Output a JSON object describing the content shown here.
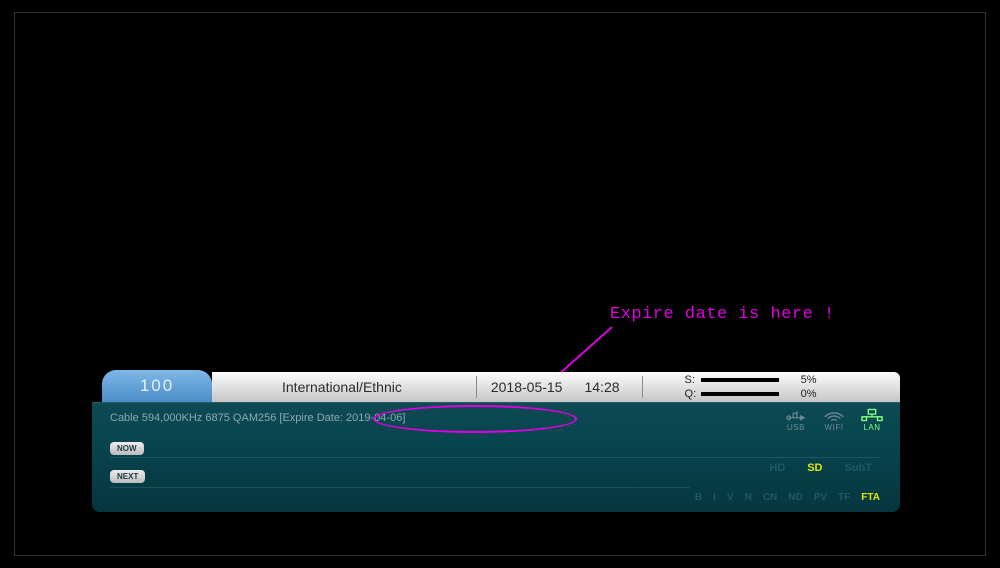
{
  "annotation": {
    "text": "Expire date is here !"
  },
  "osd": {
    "channel_number": "100",
    "header": {
      "name": "International/Ethnic",
      "date": "2018-05-15",
      "time": "14:28",
      "signal": {
        "label": "S:",
        "value": "5%"
      },
      "quality": {
        "label": "Q:",
        "value": "0%"
      }
    },
    "cable": {
      "info": "Cable 594,000KHz 6875 QAM256",
      "expire": "[Expire Date: 2019-04-06]"
    },
    "pills": {
      "now": "NOW",
      "next": "NEXT"
    },
    "conn": {
      "usb": "USB",
      "wifi": "WIFI",
      "lan": "LAN"
    },
    "tags": {
      "hd": "HD",
      "sd": "SD",
      "subt": "SubT"
    },
    "flags": [
      "B",
      "I",
      "V",
      "N",
      "CN",
      "ND",
      "PV",
      "TF",
      "FTA"
    ]
  }
}
